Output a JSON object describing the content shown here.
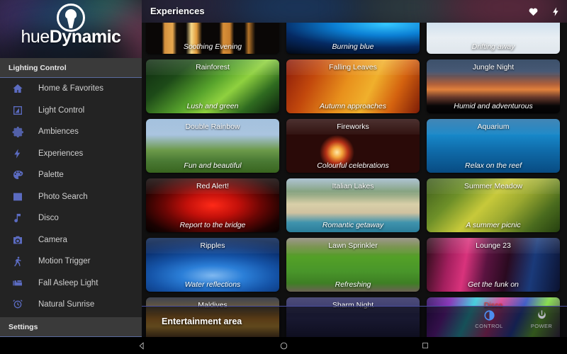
{
  "app": {
    "logo_text_light": "hue",
    "logo_text_bold": "Dynamic",
    "logo_icon": "hue-bulb-icon"
  },
  "sidebar": {
    "section_header": "Lighting Control",
    "settings_header": "Settings",
    "items": [
      {
        "label": "Home & Favorites",
        "icon": "home-icon"
      },
      {
        "label": "Light Control",
        "icon": "light-control-icon"
      },
      {
        "label": "Ambiences",
        "icon": "gear-icon"
      },
      {
        "label": "Experiences",
        "icon": "bolt-icon"
      },
      {
        "label": "Palette",
        "icon": "palette-icon"
      },
      {
        "label": "Photo Search",
        "icon": "photo-icon"
      },
      {
        "label": "Disco",
        "icon": "music-note-icon"
      },
      {
        "label": "Camera",
        "icon": "camera-icon"
      },
      {
        "label": "Motion Trigger",
        "icon": "walking-person-icon"
      },
      {
        "label": "Fall Asleep Light",
        "icon": "bed-icon"
      },
      {
        "label": "Natural Sunrise",
        "icon": "alarm-clock-icon"
      }
    ]
  },
  "header": {
    "title": "Experiences",
    "actions": [
      {
        "name": "favorite-icon",
        "icon": "heart-icon"
      },
      {
        "name": "experiences-icon",
        "icon": "bolt-icon"
      }
    ]
  },
  "grid": {
    "cards": [
      {
        "title": "",
        "subtitle": "Soothing Evening",
        "art": "art-soothing"
      },
      {
        "title": "",
        "subtitle": "Burning blue",
        "art": "art-burning"
      },
      {
        "title": "",
        "subtitle": "Drifting away",
        "art": "art-drifting"
      },
      {
        "title": "Rainforest",
        "subtitle": "Lush and green",
        "art": "art-rainforest"
      },
      {
        "title": "Falling Leaves",
        "subtitle": "Autumn approaches",
        "art": "art-falling"
      },
      {
        "title": "Jungle Night",
        "subtitle": "Humid and adventurous",
        "art": "art-jungle"
      },
      {
        "title": "Double Rainbow",
        "subtitle": "Fun and beautiful",
        "art": "art-rainbowcard"
      },
      {
        "title": "Fireworks",
        "subtitle": "Colourful celebrations",
        "art": "art-fireworks"
      },
      {
        "title": "Aquarium",
        "subtitle": "Relax on the reef",
        "art": "art-aquarium"
      },
      {
        "title": "Red Alert!",
        "subtitle": "Report to the bridge",
        "art": "art-redalert"
      },
      {
        "title": "Italian Lakes",
        "subtitle": "Romantic getaway",
        "art": "art-italian"
      },
      {
        "title": "Summer Meadow",
        "subtitle": "A summer picnic",
        "art": "art-meadow"
      },
      {
        "title": "Ripples",
        "subtitle": "Water reflections",
        "art": "art-ripples"
      },
      {
        "title": "Lawn Sprinkler",
        "subtitle": "Refreshing",
        "art": "art-sprinkler"
      },
      {
        "title": "Lounge 23",
        "subtitle": "Get the funk on",
        "art": "art-lounge"
      },
      {
        "title": "Maldives",
        "subtitle": "",
        "art": "art-maldives"
      },
      {
        "title": "Sharm Night",
        "subtitle": "",
        "art": "art-sharm"
      },
      {
        "title": "Disco",
        "subtitle": "",
        "art": "art-disco",
        "title_color": "#e03c3c"
      }
    ]
  },
  "entertainment_bar": {
    "title": "Entertainment area",
    "buttons": [
      {
        "label": "CONTROL",
        "icon": "brightness-icon",
        "color": "#4d8ef0"
      },
      {
        "label": "POWER",
        "icon": "power-icon",
        "color": "#b9b9c4"
      }
    ]
  },
  "navbar": {
    "buttons": [
      {
        "name": "back-button",
        "icon": "triangle-back-icon"
      },
      {
        "name": "home-button",
        "icon": "circle-home-icon"
      },
      {
        "name": "recents-button",
        "icon": "square-recents-icon"
      }
    ]
  }
}
